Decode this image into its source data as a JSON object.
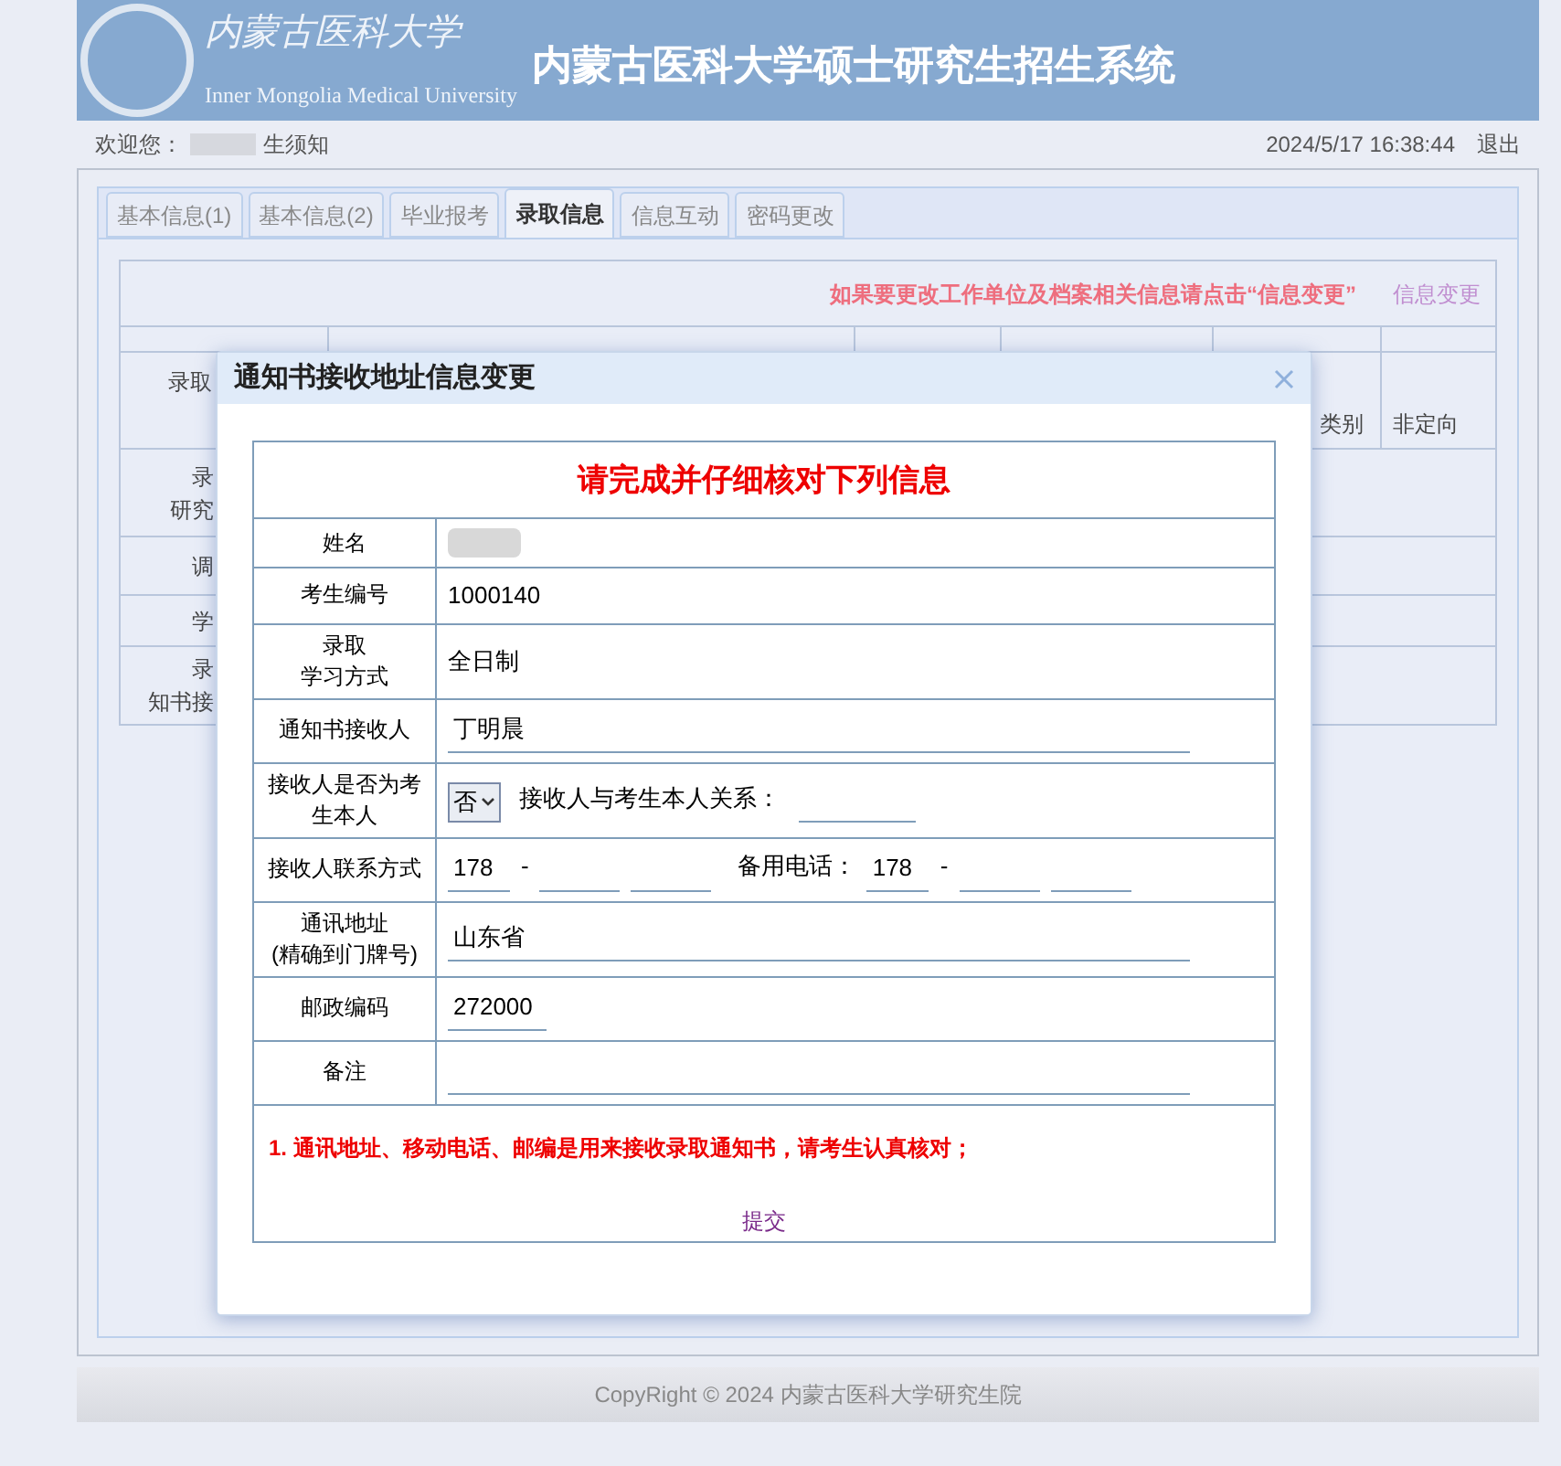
{
  "header": {
    "logo_script": "内蒙古医科大学",
    "logo_english": "Inner Mongolia Medical University",
    "system_title": "内蒙古医科大学硕士研究生招生系统"
  },
  "welcome": {
    "label": "欢迎您：",
    "link": "生须知",
    "datetime": "2024/5/17 16:38:44",
    "logout": "退出"
  },
  "tabs": [
    {
      "label": "基本信息(1)",
      "selected": false
    },
    {
      "label": "基本信息(2)",
      "selected": false
    },
    {
      "label": "毕业报考",
      "selected": false
    },
    {
      "label": "录取信息",
      "selected": true
    },
    {
      "label": "信息互动",
      "selected": false
    },
    {
      "label": "密码更改",
      "selected": false
    }
  ],
  "admission_table": {
    "notice": "如果要更改工作单位及档案相关信息请点击“信息变更”",
    "change_link": "信息变更",
    "row_2": {
      "label": "录取",
      "label_2": "类别",
      "value": "非定向"
    },
    "left_labels": [
      [
        "录",
        "研究"
      ],
      [
        "调"
      ],
      [
        "学"
      ],
      [
        "录",
        "知书接"
      ]
    ]
  },
  "dialog": {
    "title": "通知书接收地址信息变更",
    "heading": "请完成并仔细核对下列信息",
    "rows": [
      {
        "kind": "text",
        "label": [
          "姓名"
        ]
      },
      {
        "kind": "text",
        "label": [
          "考生编号"
        ],
        "value": "1000140"
      },
      {
        "kind": "text",
        "label": [
          "录取",
          "学习方式"
        ],
        "value": "全日制"
      },
      {
        "kind": "input",
        "label": [
          "通知书接收人"
        ],
        "value": "丁明晨"
      },
      {
        "kind": "relation",
        "label": [
          "接收人是否为考",
          "生本人"
        ],
        "select": "否",
        "relation_label": "接收人与考生本人关系："
      },
      {
        "kind": "phone",
        "label": [
          "接收人联系方式"
        ],
        "phone": [
          "178",
          "-"
        ],
        "backup_label": "备用电话：",
        "backup": [
          "178",
          "-"
        ]
      },
      {
        "kind": "input",
        "label": [
          "通讯地址",
          "(精确到门牌号)"
        ],
        "value": "山东省"
      },
      {
        "kind": "short",
        "label": [
          "邮政编码"
        ],
        "value": "272000"
      },
      {
        "kind": "input",
        "label": [
          "备注"
        ]
      }
    ],
    "note": "1. 通讯地址、移动电话、邮编是用来接收录取通知书，请考生认真核对；",
    "submit": "提交"
  },
  "footer": "CopyRight © 2024 内蒙古医科大学研究生院"
}
